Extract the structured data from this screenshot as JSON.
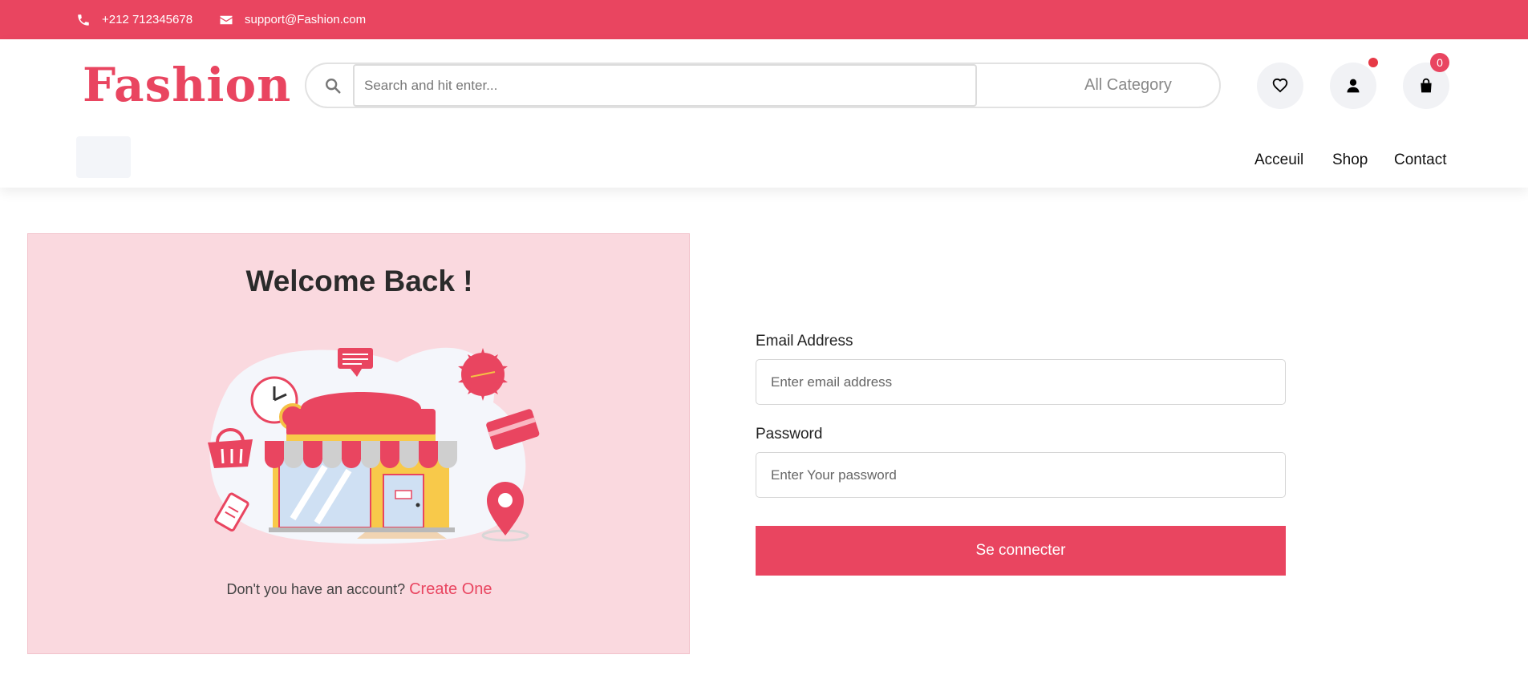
{
  "topbar": {
    "phone": "+212 712345678",
    "email": "support@Fashion.com",
    "phone_icon": "phone-icon",
    "email_icon": "envelope-icon"
  },
  "header": {
    "logo": "Fashion",
    "search_placeholder": "Search and hit enter...",
    "category_label": "All Category",
    "cart_count": "0",
    "icons": [
      "search-icon",
      "heart-icon",
      "user-icon",
      "shopping-bag-icon"
    ]
  },
  "nav": {
    "items": [
      "Acceuil",
      "Shop",
      "Contact"
    ]
  },
  "welcome_panel": {
    "title": "Welcome Back !",
    "no_account_text": "Don't you have an account?",
    "create_link": "Create One"
  },
  "login_form": {
    "email_label": "Email Address",
    "email_placeholder": "Enter email address",
    "password_label": "Password",
    "password_placeholder": "Enter Your password",
    "submit_label": "Se connecter"
  },
  "colors": {
    "accent": "#e94560",
    "panel_bg": "#fad9df",
    "icon_circle_bg": "#f1f2f5"
  }
}
